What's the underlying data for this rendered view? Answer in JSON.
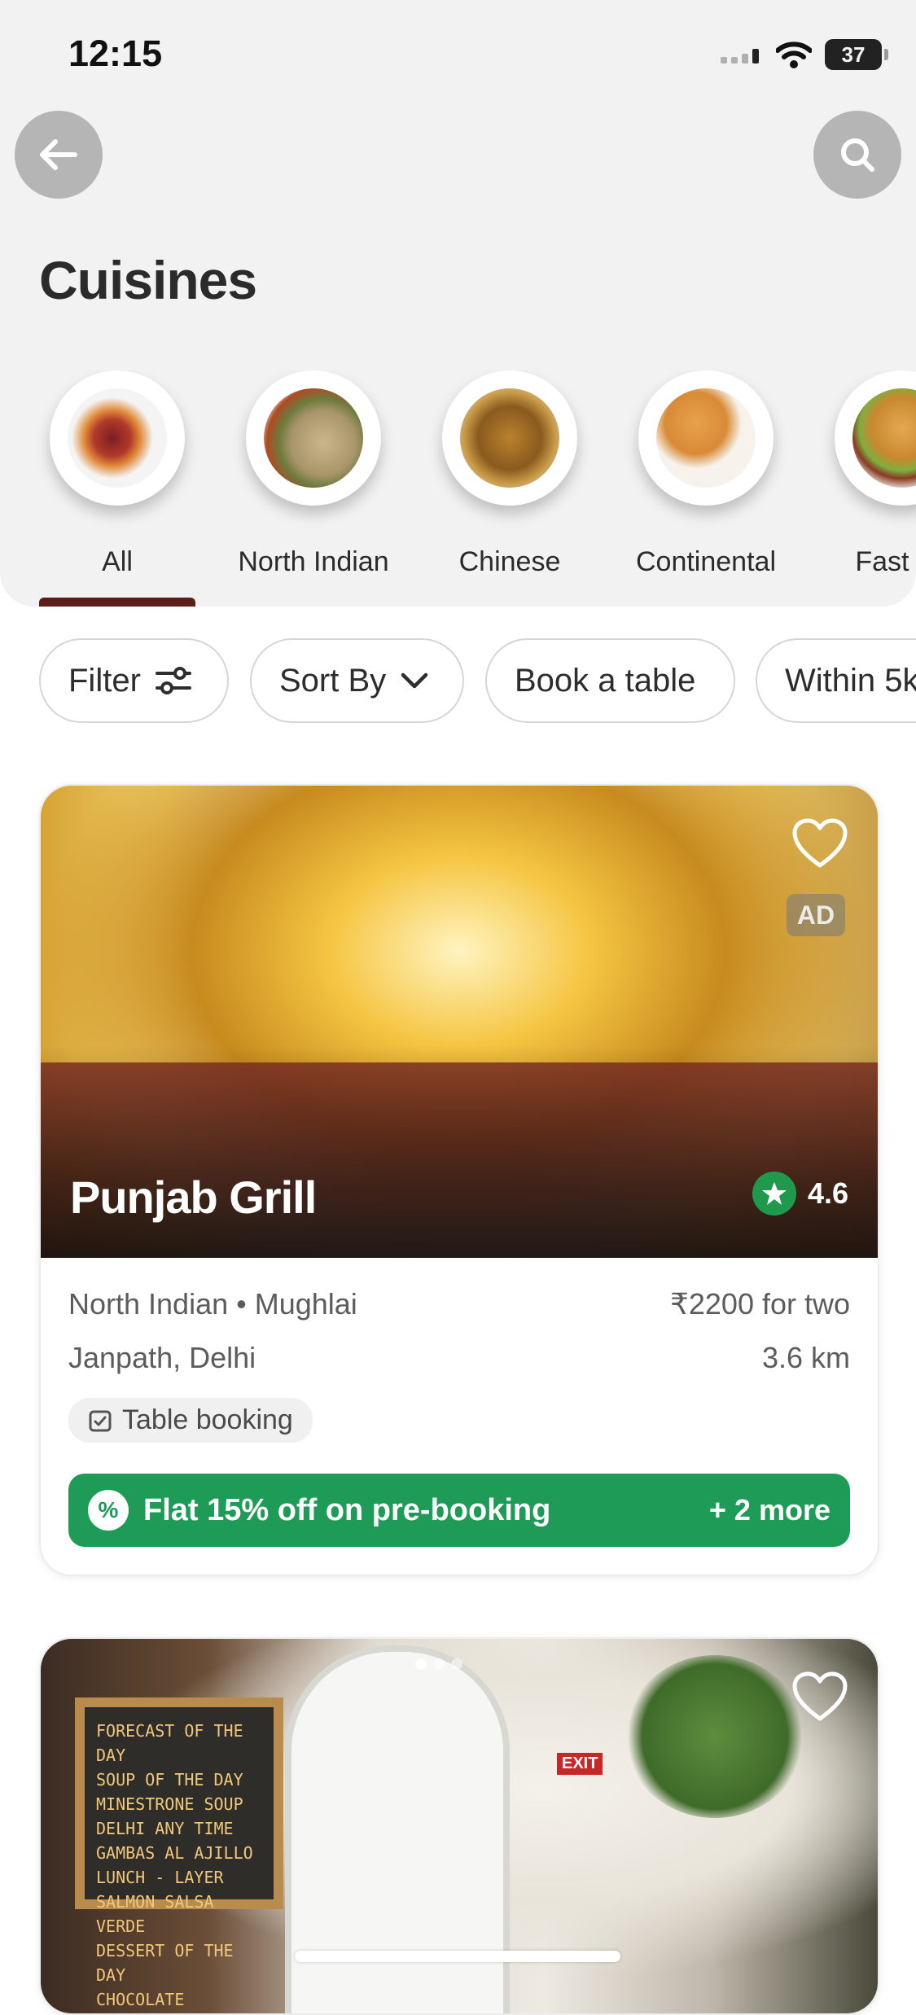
{
  "status_bar": {
    "time": "12:15",
    "battery": "37"
  },
  "header": {
    "title": "Cuisines",
    "back_icon": "arrow-left-icon",
    "search_icon": "search-icon"
  },
  "cuisines": [
    {
      "label": "All",
      "active": true
    },
    {
      "label": "North Indian",
      "active": false
    },
    {
      "label": "Chinese",
      "active": false
    },
    {
      "label": "Continental",
      "active": false
    },
    {
      "label": "Fast Fo",
      "active": false
    }
  ],
  "filters": [
    {
      "label": "Filter",
      "icon": "sliders-icon"
    },
    {
      "label": "Sort By",
      "icon": "chevron-down-icon"
    },
    {
      "label": "Book a table"
    },
    {
      "label": "Within 5k"
    }
  ],
  "restaurants": [
    {
      "name": "Punjab Grill",
      "rating": "4.6",
      "ad_label": "AD",
      "cuisines": "North Indian • Mughlai",
      "price": "₹2200 for two",
      "location": "Janpath, Delhi",
      "distance": "3.6 km",
      "tag": "Table booking",
      "offer": "Flat 15% off on pre-booking",
      "offer_icon": "%",
      "offer_more": "+ 2 more"
    },
    {
      "chalkboard_text": "FORECAST OF THE DAY\nSOUP OF THE DAY\nMINESTRONE SOUP\nDELHI ANY TIME\nGAMBAS AL AJILLO\nLUNCH - LAYER\nSALMON SALSA VERDE\nDESSERT OF THE DAY\nCHOCOLATE CAPPUCCINO",
      "sign_text": "EXIT"
    }
  ],
  "colors": {
    "accent_underline": "#5a1f1a",
    "rating_green": "#1f9a4d",
    "offer_green": "#1e9b56"
  }
}
